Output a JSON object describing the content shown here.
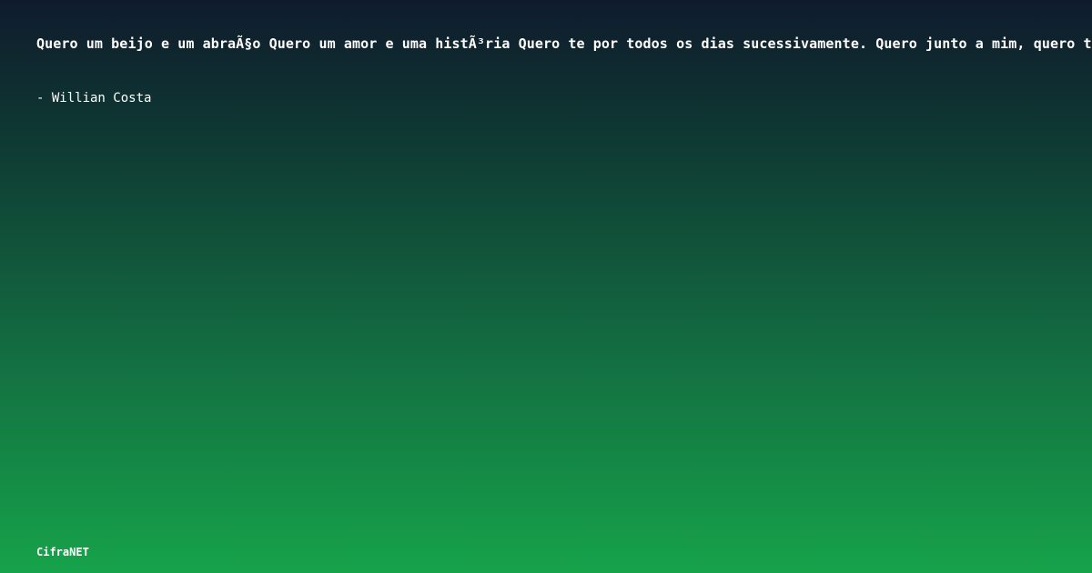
{
  "quote": {
    "text": "Quero um beijo e um abraÃ§o Quero um amor e uma histÃ³ria Quero te por todos os dias sucessivamente. Quero junto a mim, quero te"
  },
  "author": {
    "text": "- Willian Costa"
  },
  "brand": {
    "name": "CifraNET"
  }
}
